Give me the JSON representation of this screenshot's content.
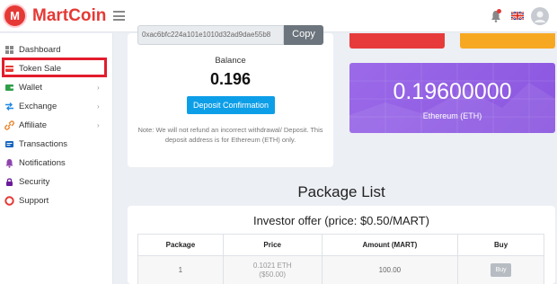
{
  "brand": {
    "name": "MartCoin",
    "logo_letter": "M"
  },
  "colors": {
    "brand": "#e53935",
    "primary": "#0d9ee8",
    "eth_card": "#9060e4",
    "active_highlight": "#e31c2d"
  },
  "sidebar": {
    "items": [
      {
        "label": "Dashboard",
        "icon": "dashboard-icon",
        "has_submenu": false
      },
      {
        "label": "Token Sale",
        "icon": "token-sale-icon",
        "has_submenu": false,
        "active": true
      },
      {
        "label": "Wallet",
        "icon": "wallet-icon",
        "has_submenu": true
      },
      {
        "label": "Exchange",
        "icon": "exchange-icon",
        "has_submenu": true
      },
      {
        "label": "Affiliate",
        "icon": "affiliate-icon",
        "has_submenu": true
      },
      {
        "label": "Transactions",
        "icon": "transactions-icon",
        "has_submenu": false
      },
      {
        "label": "Notifications",
        "icon": "bell-icon",
        "has_submenu": false
      },
      {
        "label": "Security",
        "icon": "lock-icon",
        "has_submenu": false
      },
      {
        "label": "Support",
        "icon": "support-icon",
        "has_submenu": false
      }
    ]
  },
  "wallet": {
    "address": "0xac6bfc224a101e1010d32ad9dae55b8",
    "copy_label": "Copy",
    "balance_label": "Balance",
    "balance_value": "0.196",
    "deposit_label": "Deposit Confirmation",
    "note": "Note: We will not refund an incorrect withdrawal/ Deposit. This deposit address is for Ethereum (ETH) only."
  },
  "eth_card": {
    "value": "0.19600000",
    "label": "Ethereum (ETH)"
  },
  "packages": {
    "title": "Package List",
    "offer": "Investor offer (price: $0.50/MART)",
    "headers": [
      "Package",
      "Price",
      "Amount (MART)",
      "Buy"
    ],
    "rows": [
      {
        "package": "1",
        "price_eth": "0.1021 ETH",
        "price_usd": "($50.00)",
        "amount": "100.00",
        "buy_label": "Buy"
      }
    ]
  }
}
